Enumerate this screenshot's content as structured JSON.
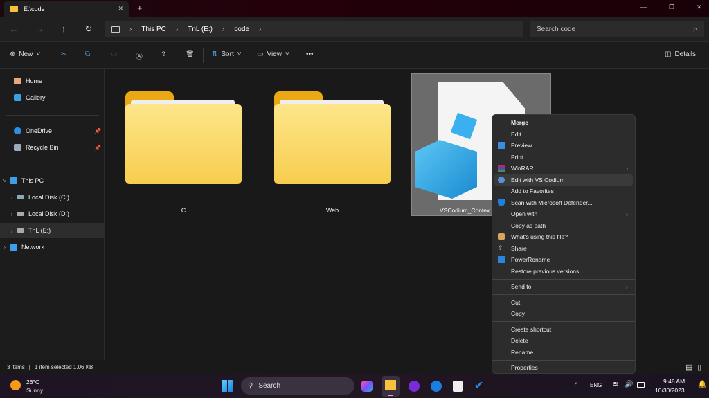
{
  "window": {
    "tab_title": "E:\\code",
    "new_tab": "+",
    "close_tab": "✕",
    "minimize": "—",
    "maximize": "❐",
    "close": "✕"
  },
  "nav": {
    "back": "←",
    "forward": "→",
    "up": "↑",
    "refresh": "↻",
    "breadcrumb": [
      "This PC",
      "TnL (E:)",
      "code"
    ],
    "search_placeholder": "Search code"
  },
  "toolbar": {
    "new": "New",
    "sort": "Sort",
    "view": "View",
    "more": "•••",
    "details": "Details"
  },
  "sidebar": {
    "items": [
      {
        "label": "Home",
        "color": "#e8a87c"
      },
      {
        "label": "Gallery",
        "color": "#3aa0e8"
      },
      {
        "label": "OneDrive",
        "color": "#2f8ee0"
      },
      {
        "label": "Recycle Bin",
        "color": "#9ab"
      },
      {
        "label": "This PC",
        "color": "#3aa0e8"
      },
      {
        "label": "Local Disk (C:)",
        "color": "#8ab"
      },
      {
        "label": "Local Disk (D:)",
        "color": "#aaa"
      },
      {
        "label": "TnL (E:)",
        "color": "#aaa"
      },
      {
        "label": "Network",
        "color": "#3aa0e8"
      }
    ]
  },
  "files": [
    {
      "name": "C"
    },
    {
      "name": "Web"
    },
    {
      "name": "VSCodium_Contex"
    }
  ],
  "context_menu": {
    "items": [
      "Merge",
      "Edit",
      "Preview",
      "Print",
      "WinRAR",
      "Edit with VS Codium",
      "Add to Favorites",
      "Scan with Microsoft Defender...",
      "Open with",
      "Copy as path",
      "What's using this file?",
      "Share",
      "PowerRename",
      "Restore previous versions",
      "Send to",
      "Cut",
      "Copy",
      "Create shortcut",
      "Delete",
      "Rename",
      "Properties"
    ]
  },
  "status": {
    "count": "3 items",
    "selected": "1 item selected  1.06 KB"
  },
  "taskbar": {
    "temp": "26°C",
    "weather": "Sunny",
    "search": "Search",
    "lang": "ENG",
    "time": "9:48 AM",
    "date": "10/30/2023"
  }
}
